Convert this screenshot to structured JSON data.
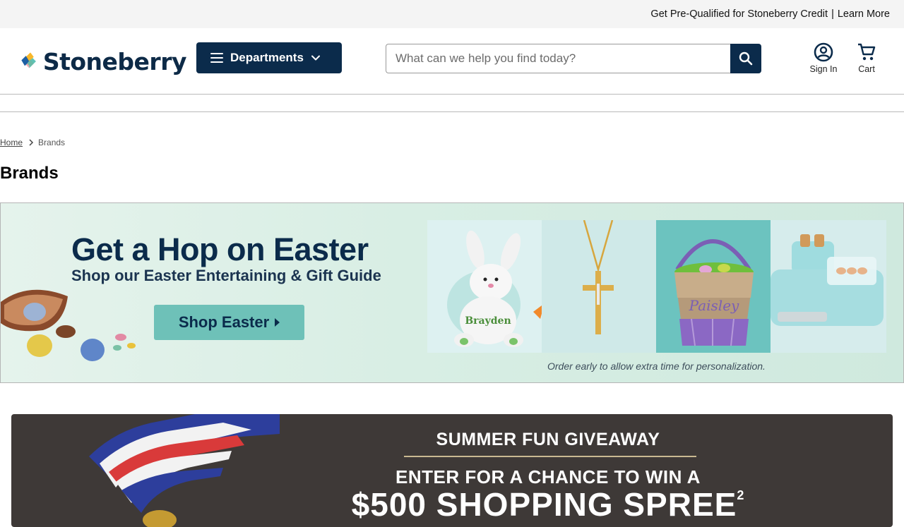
{
  "topbar": {
    "credit_text": "Get Pre-Qualified for Stoneberry Credit",
    "separator": "|",
    "learn_more": "Learn More"
  },
  "header": {
    "logo_text": "Stoneberry",
    "departments_label": "Departments",
    "search_placeholder": "What can we help you find today?",
    "sign_in_label": "Sign In",
    "cart_label": "Cart"
  },
  "breadcrumb": {
    "home": "Home",
    "current": "Brands"
  },
  "page": {
    "title": "Brands"
  },
  "easter_banner": {
    "headline": "Get a Hop on Easter",
    "subheadline": "Shop our Easter Entertaining & Gift Guide",
    "button_label": "Shop Easter",
    "bunny_name": "Brayden",
    "basket_name": "Paisley",
    "note": "Order early to allow extra time for personalization."
  },
  "promo_banner": {
    "line1": "SUMMER FUN GIVEAWAY",
    "line2": "ENTER FOR A CHANCE TO WIN A",
    "line3": "$500 SHOPPING SPREE",
    "footnote_mark": "2"
  },
  "colors": {
    "brand_navy": "#0b2b4b",
    "teal_button": "#6ec1b8",
    "topbar_bg": "#f4f4f4",
    "promo_bg": "#3e3937"
  },
  "icons": {
    "logo": "stoneberry-logo-icon",
    "menu": "hamburger-icon",
    "chevron": "chevron-down-icon",
    "search": "search-icon",
    "account": "account-circle-icon",
    "cart": "shopping-cart-icon"
  }
}
